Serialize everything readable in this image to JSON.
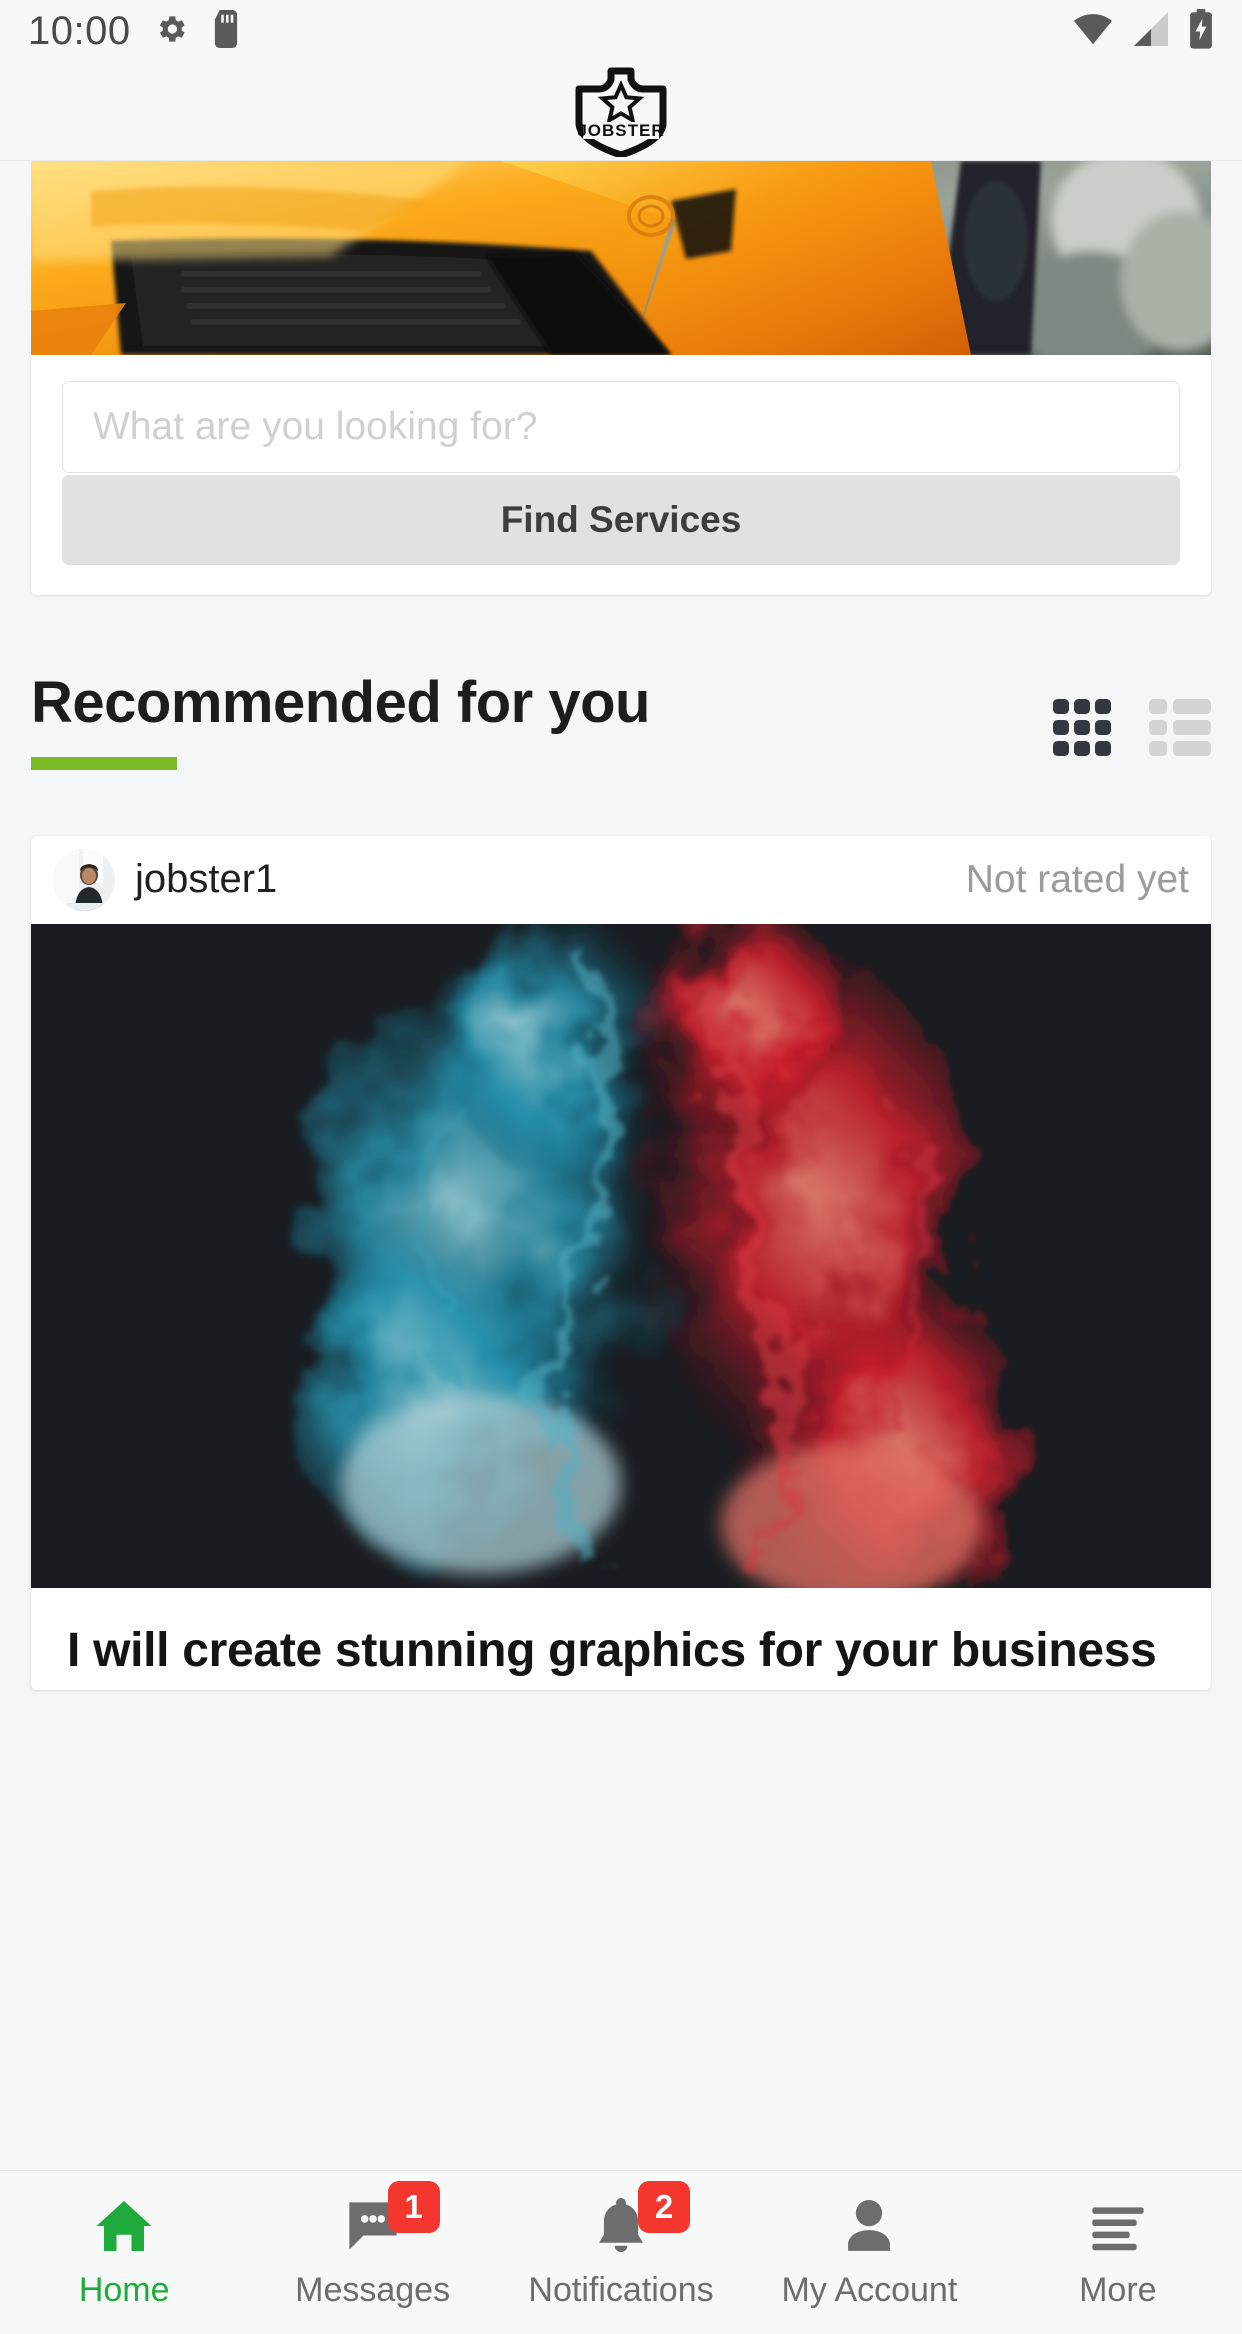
{
  "status_bar": {
    "time": "10:00",
    "icons_left": [
      "gear-icon",
      "sd-card-icon"
    ],
    "icons_right": [
      "wifi-icon",
      "signal-icon",
      "battery-charging-icon"
    ]
  },
  "header": {
    "logo_text": "JOBSTER",
    "logo_icon": "shield-star-logo"
  },
  "hero": {
    "alt": "orange sports car close-up banner"
  },
  "search": {
    "placeholder": "What are you looking for?",
    "value": "",
    "button_label": "Find Services"
  },
  "section": {
    "title": "Recommended for you",
    "accent_color": "#7CBB28",
    "grid_view_label": "grid-view",
    "list_view_label": "list-view",
    "active_view": "grid"
  },
  "gig": {
    "username": "jobster1",
    "rating_text": "Not rated yet",
    "title": "I will create stunning graphics for your business",
    "image_alt": "blue and red ink smoke on dark background"
  },
  "bottom_nav": {
    "items": [
      {
        "label": "Home",
        "icon": "home-icon",
        "badge": "",
        "active": true
      },
      {
        "label": "Messages",
        "icon": "message-icon",
        "badge": "1",
        "active": false
      },
      {
        "label": "Notifications",
        "icon": "bell-icon",
        "badge": "2",
        "active": false
      },
      {
        "label": "My Account",
        "icon": "person-icon",
        "badge": "",
        "active": false
      },
      {
        "label": "More",
        "icon": "hamburger-icon",
        "badge": "",
        "active": false
      }
    ]
  },
  "colors": {
    "accent_green": "#7CBB28",
    "nav_active": "#1faa3c",
    "badge_red": "#f4372e"
  }
}
